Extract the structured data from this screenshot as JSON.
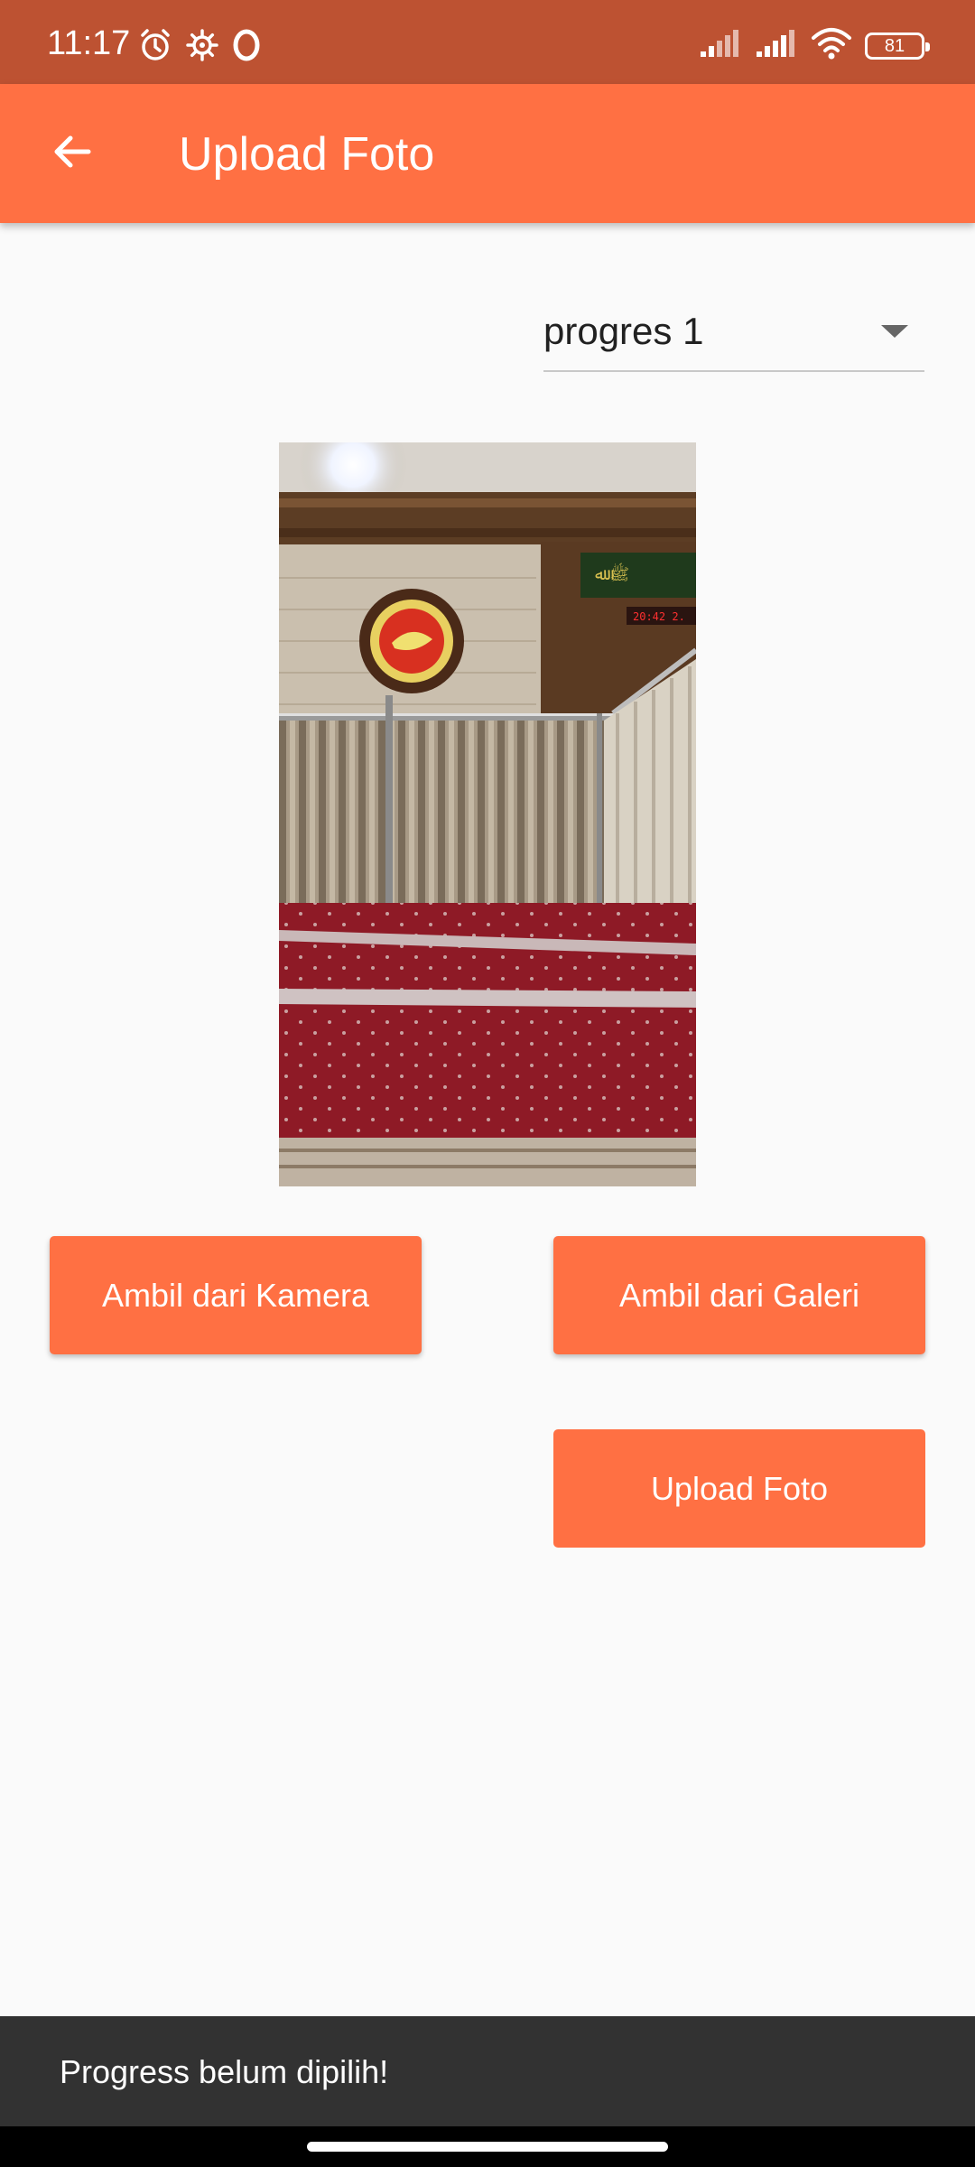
{
  "status_bar": {
    "time": "11:17",
    "battery_level": "81",
    "icons": [
      "alarm-icon",
      "settings-gear-icon",
      "opera-icon",
      "signal-icon",
      "signal-icon",
      "wifi-icon",
      "battery-icon"
    ]
  },
  "app_bar": {
    "title": "Upload Foto",
    "back_icon": "arrow-back-icon",
    "color": "#ff7043"
  },
  "dropdown": {
    "selected": "progres 1",
    "icon": "dropdown-arrow-icon"
  },
  "photo": {
    "icon": "photo-preview"
  },
  "buttons": {
    "camera": "Ambil dari Kamera",
    "gallery": "Ambil dari Galeri",
    "upload": "Upload Foto"
  },
  "snackbar": {
    "message": "Progress belum dipilih!"
  },
  "colors": {
    "accent": "#ff7043",
    "status_bar": "#bd5232",
    "snackbar": "#323232"
  }
}
